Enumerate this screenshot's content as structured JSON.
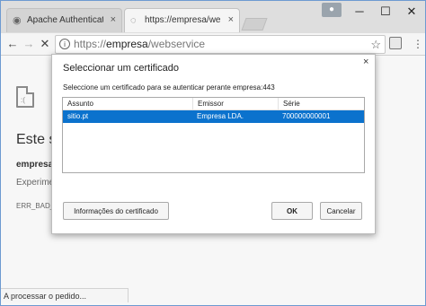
{
  "browser": {
    "tabs": [
      {
        "title": "Apache Authentication w",
        "close": "×"
      },
      {
        "title": "https://empresa/webserv",
        "close": "×"
      }
    ],
    "window_controls": {
      "minimize": "─",
      "maximize": "☐",
      "close": "✕"
    },
    "toolbar": {
      "back": "←",
      "forward": "→",
      "stop": "✕",
      "star": "☆",
      "menu": "⋮"
    },
    "address": {
      "scheme": "https://",
      "host": "empresa",
      "path": "/webservice"
    },
    "status": "A processar o pedido..."
  },
  "error_page": {
    "title": "Este s",
    "host": "empresa",
    "suggestion": "Experime",
    "code": "ERR_BAD_S"
  },
  "dialog": {
    "title": "Seleccionar um certificado",
    "close": "×",
    "subtitle": "Seleccione um certificado para se autenticar perante empresa:443",
    "columns": [
      "Assunto",
      "Emissor",
      "Série"
    ],
    "rows": [
      {
        "subject": "sitio.pt",
        "issuer": "Empresa LDA.",
        "serial": "700000000001",
        "selected": true
      }
    ],
    "buttons": {
      "info": "Informações do certificado",
      "ok": "OK",
      "cancel": "Cancelar"
    }
  },
  "colors": {
    "selection": "#0b72cd",
    "window_border": "#6d9ad1"
  }
}
